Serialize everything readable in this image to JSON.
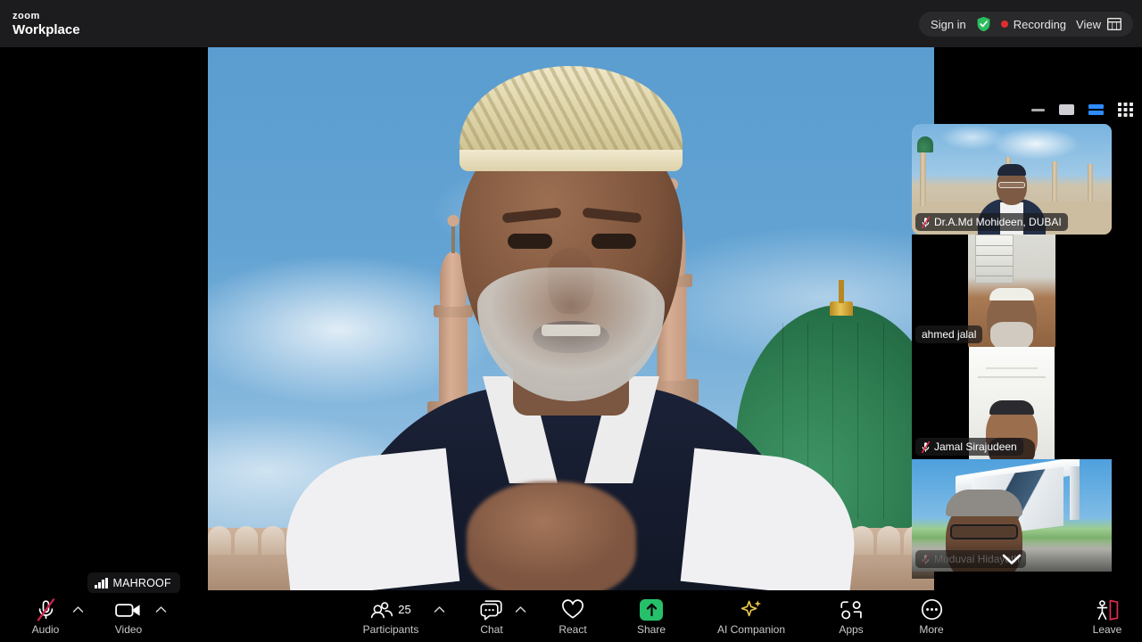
{
  "app": {
    "brand_line1": "zoom",
    "brand_line2": "Workplace"
  },
  "topbar": {
    "sign_in_label": "Sign in",
    "shield_icon": "shield-check-icon",
    "recording_label": "Recording",
    "recording_dot_color": "#e02d2d",
    "view_label": "View",
    "view_icon": "layout-icon"
  },
  "view_controls": [
    {
      "name": "minimize",
      "icon": "minimize-icon",
      "active": false
    },
    {
      "name": "fullscreen",
      "icon": "single-screen-icon",
      "active": false
    },
    {
      "name": "speaker-view",
      "icon": "speaker-view-icon",
      "active": true
    },
    {
      "name": "gallery-view",
      "icon": "gallery-grid-icon",
      "active": false
    }
  ],
  "main_video": {
    "speaker_name": "MAHROOF",
    "audio_indicator_icon": "audio-level-bars-icon",
    "background": "mosque-virtual-background"
  },
  "participants_strip": {
    "scroll_down_icon": "chevron-down-icon",
    "items": [
      {
        "name": "Dr.A.Md Mohideen, DUBAI",
        "muted": true,
        "mute_icon": "mic-muted-icon",
        "speaking": true,
        "dim": false
      },
      {
        "name": "ahmed jalal",
        "muted": false,
        "mute_icon": "",
        "speaking": false,
        "dim": false
      },
      {
        "name": "Jamal Sirajudeen",
        "muted": true,
        "mute_icon": "mic-muted-icon",
        "speaking": false,
        "dim": false
      },
      {
        "name": "Muduvai Hidayath",
        "muted": true,
        "mute_icon": "mic-muted-icon",
        "speaking": false,
        "dim": true
      }
    ]
  },
  "toolbar": {
    "audio": {
      "label": "Audio",
      "icon": "mic-muted-icon",
      "muted": true,
      "caret_icon": "chevron-up-icon"
    },
    "video": {
      "label": "Video",
      "icon": "camera-icon",
      "muted": false,
      "caret_icon": "chevron-up-icon"
    },
    "participants": {
      "label": "Participants",
      "icon": "people-icon",
      "count": "25",
      "caret_icon": "chevron-up-icon"
    },
    "chat": {
      "label": "Chat",
      "icon": "chat-bubble-icon",
      "caret_icon": "chevron-up-icon"
    },
    "react": {
      "label": "React",
      "icon": "heart-icon"
    },
    "share": {
      "label": "Share",
      "icon": "share-screen-icon",
      "accent_color": "#27c06a"
    },
    "ai_companion": {
      "label": "AI Companion",
      "icon": "sparkle-icon",
      "accent_color": "#e8c44c"
    },
    "apps": {
      "label": "Apps",
      "icon": "apps-icon"
    },
    "more": {
      "label": "More",
      "icon": "ellipsis-circle-icon"
    },
    "leave": {
      "label": "Leave",
      "icon": "leave-door-icon",
      "accent_color": "#e02d4d"
    }
  }
}
